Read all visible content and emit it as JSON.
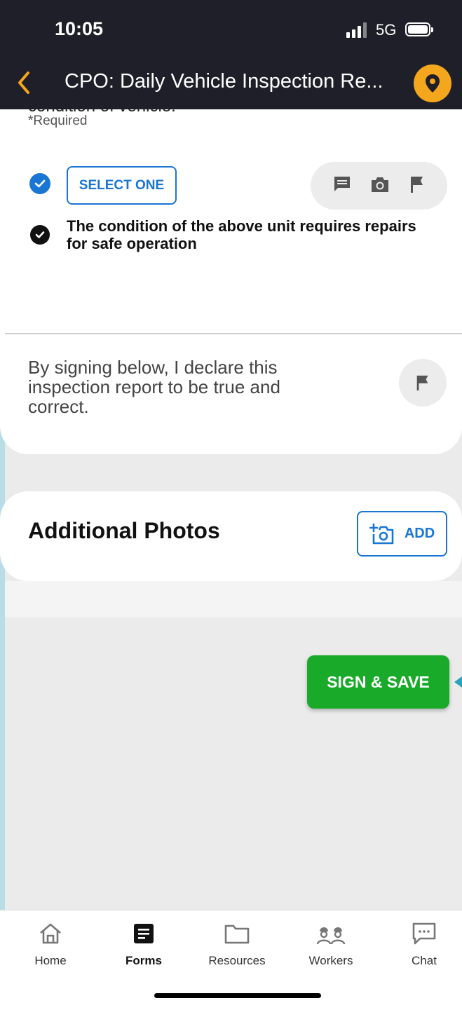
{
  "status_bar": {
    "time": "10:05",
    "network": "5G"
  },
  "header": {
    "title": "CPO: Daily Vehicle Inspection Re..."
  },
  "form": {
    "cut_question": "condition of vehicle.",
    "required_label": "*Required",
    "select_button": "SELECT ONE",
    "condition_text": "The condition of the above unit requires repairs for safe operation",
    "declaration": "By signing below, I declare this inspection report to be true and correct."
  },
  "photos": {
    "title": "Additional Photos",
    "add_label": "ADD"
  },
  "actions": {
    "sign_save": "SIGN & SAVE"
  },
  "tabs": [
    {
      "label": "Home",
      "icon": "home-icon",
      "active": false
    },
    {
      "label": "Forms",
      "icon": "forms-icon",
      "active": true
    },
    {
      "label": "Resources",
      "icon": "folder-icon",
      "active": false
    },
    {
      "label": "Workers",
      "icon": "workers-icon",
      "active": false
    },
    {
      "label": "Chat",
      "icon": "chat-icon",
      "active": false
    }
  ],
  "colors": {
    "accent": "#1976d2",
    "primary_action": "#1aaa2a",
    "header_bg": "#1f1f29",
    "pin": "#f4a71d",
    "back_chevron": "#f4a71d"
  }
}
